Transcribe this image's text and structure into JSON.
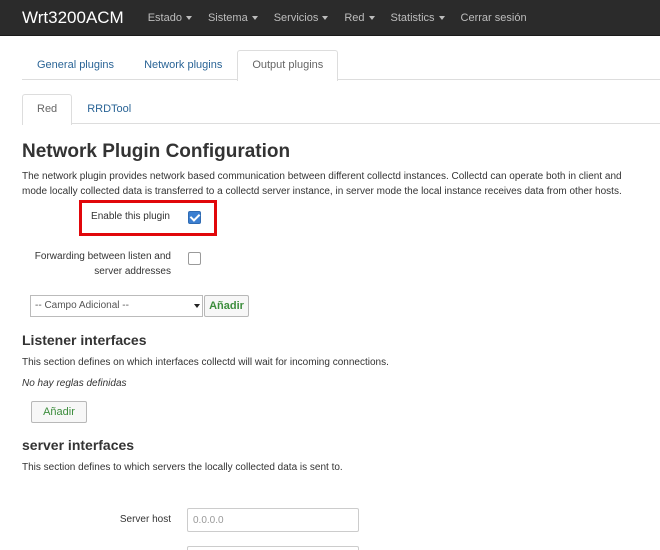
{
  "navbar": {
    "brand": "Wrt3200ACM",
    "items": [
      {
        "label": "Estado",
        "dropdown": true
      },
      {
        "label": "Sistema",
        "dropdown": true
      },
      {
        "label": "Servicios",
        "dropdown": true
      },
      {
        "label": "Red",
        "dropdown": true
      },
      {
        "label": "Statistics",
        "dropdown": true
      },
      {
        "label": "Cerrar sesión",
        "dropdown": false
      }
    ]
  },
  "tabs": [
    {
      "label": "General plugins",
      "active": false
    },
    {
      "label": "Network plugins",
      "active": false
    },
    {
      "label": "Output plugins",
      "active": true
    }
  ],
  "subtabs": [
    {
      "label": "Red",
      "active": true
    },
    {
      "label": "RRDTool",
      "active": false
    }
  ],
  "main": {
    "title": "Network Plugin Configuration",
    "description_line1": "The network plugin provides network based communication between different collectd instances. Collectd can operate both in client and",
    "description_line2": "mode locally collected data is transferred to a collectd server instance, in server mode the local instance receives data from other hosts."
  },
  "form": {
    "enable_label": "Enable this plugin",
    "enable_checked": true,
    "forwarding_label_line1": "Forwarding between listen and",
    "forwarding_label_line2": "server addresses",
    "forwarding_checked": false,
    "extra_field_selected": "-- Campo Adicional --",
    "add_label": "Añadir"
  },
  "listener": {
    "title": "Listener interfaces",
    "description": "This section defines on which interfaces collectd will wait for incoming connections.",
    "empty_text": "No hay reglas definidas",
    "add_label": "Añadir"
  },
  "server": {
    "title": "server interfaces",
    "description": "This section defines to which servers the locally collected data is sent to.",
    "host_label": "Server host",
    "host_placeholder": "0.0.0.0"
  },
  "colors": {
    "navbar_bg": "#2b2b2b",
    "link": "#2a6496",
    "highlight": "#e1070b",
    "add_text": "#3c8d3c",
    "checkbox_checked": "#3b7fd1"
  }
}
